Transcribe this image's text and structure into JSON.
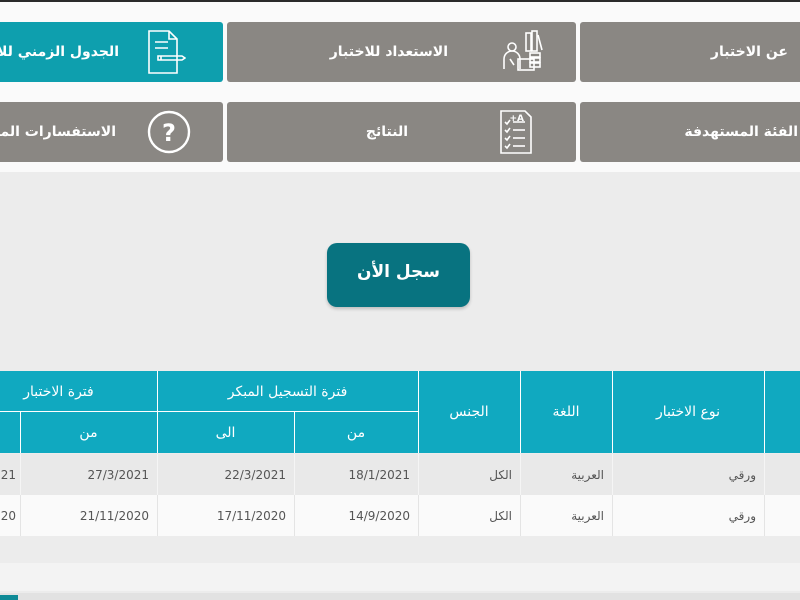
{
  "nav": {
    "about": "عن الاختبار",
    "prep": "الاستعداد للاختبار",
    "schedule": "الجدول الزمني للاختبار",
    "target": "الفئة المستهدفة",
    "results": "النتائج",
    "faq": "الاستفسارات المتكررة"
  },
  "cta": {
    "label": "سجل الأن"
  },
  "table": {
    "headers": {
      "test_type": "نوع الاختبار",
      "language": "اللغة",
      "gender": "الجنس",
      "early_reg": "فترة التسجيل المبكر",
      "test_period": "فترة الاختبار",
      "from": "من",
      "to": "الى",
      "from2": "من"
    },
    "rows": [
      {
        "type": "ورقي",
        "language": "العربية",
        "gender": "الكل",
        "early_from": "18/1/2021",
        "early_to": "22/3/2021",
        "test_from": "27/3/2021",
        "test_to_partial": "21"
      },
      {
        "type": "ورقي",
        "language": "العربية",
        "gender": "الكل",
        "early_from": "14/9/2020",
        "early_to": "17/11/2020",
        "test_from": "21/11/2020",
        "test_to_partial": "20"
      }
    ]
  },
  "colors": {
    "gray_button": "#8a8783",
    "teal_button": "#0e9fae",
    "cta": "#087380",
    "table_header": "#10a9c0"
  }
}
